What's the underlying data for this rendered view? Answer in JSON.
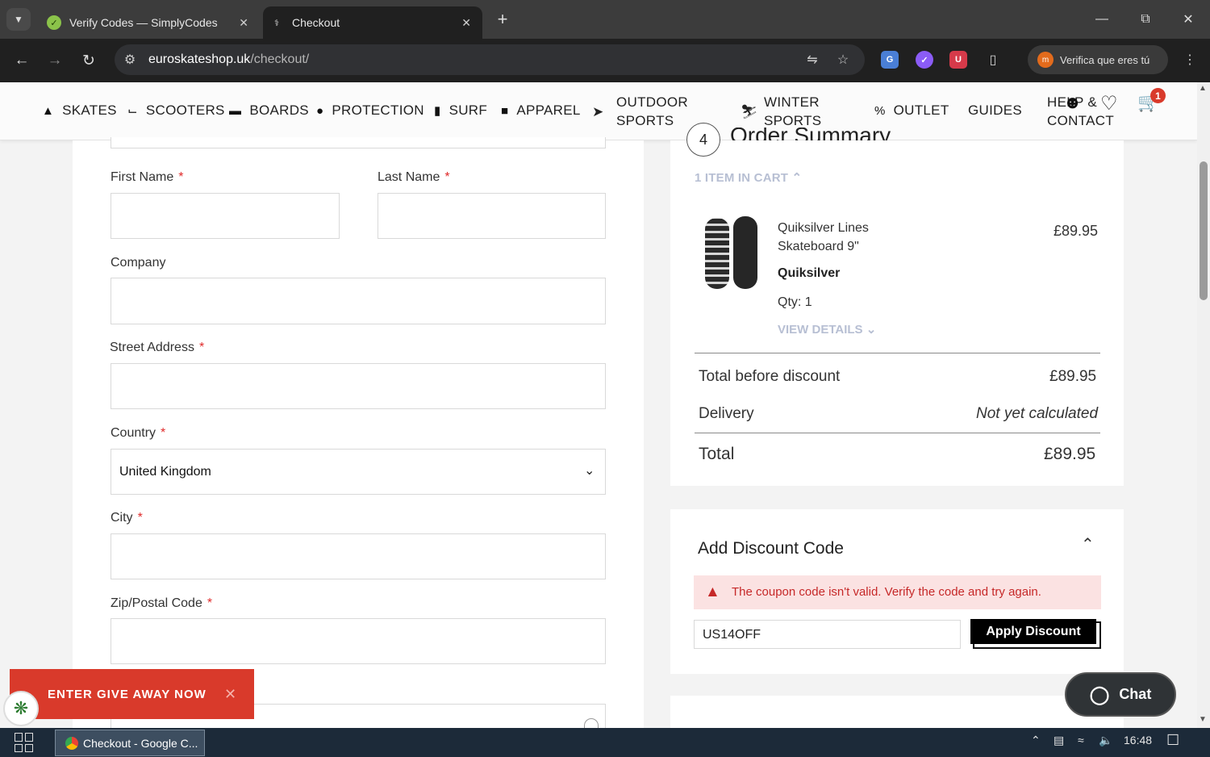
{
  "browser": {
    "tabs": [
      {
        "title": "Verify Codes — SimplyCodes",
        "active": false
      },
      {
        "title": "Checkout",
        "active": true
      }
    ],
    "url_domain": "euroskateshop.uk",
    "url_path": "/checkout/",
    "profile_label": "Verifica que eres tú"
  },
  "site": {
    "nav": [
      {
        "label": "SKATES",
        "icon": "skate-icon"
      },
      {
        "label": "SCOOTERS",
        "icon": "scooter-icon"
      },
      {
        "label": "BOARDS",
        "icon": "board-icon"
      },
      {
        "label": "PROTECTION",
        "icon": "helmet-icon"
      },
      {
        "label": "SURF",
        "icon": "surfboard-icon"
      },
      {
        "label": "APPAREL",
        "icon": "apparel-icon"
      }
    ],
    "nav_outdoor_1": "OUTDOOR",
    "nav_outdoor_2": "SPORTS",
    "nav_winter_1": "WINTER",
    "nav_winter_2": "SPORTS",
    "nav_outlet": "OUTLET",
    "nav_guides": "GUIDES",
    "nav_help_1": "HELP &",
    "nav_help_2": "CONTACT",
    "cart_count": "1"
  },
  "form": {
    "first_name_label": "First Name",
    "last_name_label": "Last Name",
    "company_label": "Company",
    "street_label": "Street Address",
    "country_label": "Country",
    "country_value": "United Kingdom",
    "city_label": "City",
    "zip_label": "Zip/Postal Code",
    "required_mark": "*"
  },
  "summary": {
    "step_number": "4",
    "title": "Order Summary",
    "items_in_cart": "1 ITEM IN CART",
    "product_name_1": "Quiksilver Lines",
    "product_name_2": "Skateboard 9\"",
    "brand": "Quiksilver",
    "qty": "Qty: 1",
    "price": "£89.95",
    "view_details": "VIEW DETAILS",
    "total_before_label": "Total before discount",
    "total_before_value": "£89.95",
    "delivery_label": "Delivery",
    "delivery_value": "Not yet calculated",
    "total_label": "Total",
    "total_value": "£89.95"
  },
  "discount": {
    "title": "Add Discount Code",
    "error": "The coupon code isn't valid. Verify the code and try again.",
    "code_value": "US14OFF",
    "apply_label": "Apply Discount"
  },
  "giveaway_label": "ENTER GIVE AWAY NOW",
  "chat_label": "Chat",
  "taskbar": {
    "app_label": "Checkout - Google C...",
    "time": "16:48"
  },
  "colors": {
    "accent_red": "#d93a2b",
    "error_bg": "#fbe2e2",
    "error_text": "#c62828",
    "chat_bg": "#2f3336"
  }
}
